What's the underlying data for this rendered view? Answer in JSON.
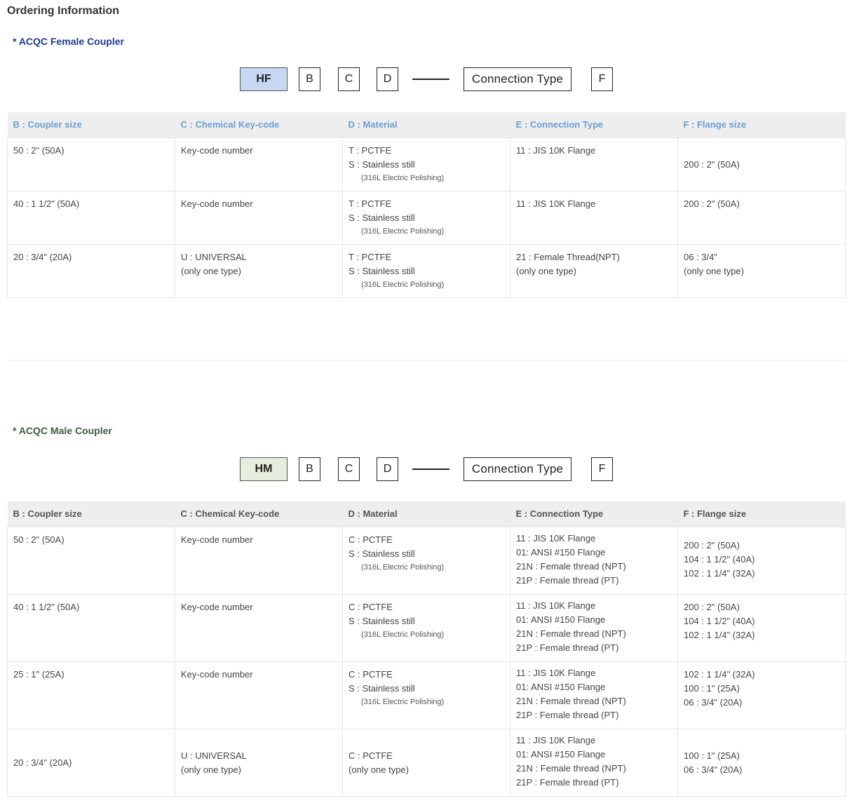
{
  "page_title": "Ordering Information",
  "female": {
    "title": "* ACQC Female Coupler",
    "code": {
      "prefix": "HF",
      "b": "B",
      "c": "C",
      "d": "D",
      "conn": "Connection Type",
      "f": "F"
    },
    "headers": [
      "B : Coupler size",
      "C : Chemical Key-code",
      "D : Material",
      "E : Connection Type",
      "F : Flange size"
    ],
    "rows": [
      {
        "b": [
          "50 : 2\" (50A)"
        ],
        "c": [
          "Key-code number"
        ],
        "d": [
          "T : PCTFE",
          "S : Stainless still"
        ],
        "d_note": "(316L Electric Polishing)",
        "e": [
          "11 : JIS 10K Flange"
        ],
        "f": [
          "200 : 2\" (50A)"
        ]
      },
      {
        "b": [
          "40 : 1 1/2\" (50A)"
        ],
        "c": [
          "Key-code number"
        ],
        "d": [
          "T : PCTFE",
          "S : Stainless still"
        ],
        "d_note": "(316L Electric Polishing)",
        "e": [
          "11 : JIS 10K Flange"
        ],
        "f": [
          "200 : 2\" (50A)"
        ]
      },
      {
        "b": [
          "20 : 3/4\" (20A)"
        ],
        "c": [
          "U : UNIVERSAL",
          "(only one type)"
        ],
        "d": [
          "T : PCTFE",
          "S : Stainless still"
        ],
        "d_note": "(316L Electric Polishing)",
        "e": [
          "21 : Female Thread(NPT)",
          "(only one type)"
        ],
        "f": [
          "06 : 3/4\"",
          "(only one type)"
        ]
      }
    ]
  },
  "male": {
    "title": "* ACQC Male Coupler",
    "code": {
      "prefix": "HM",
      "b": "B",
      "c": "C",
      "d": "D",
      "conn": "Connection Type",
      "f": "F"
    },
    "headers": [
      "B : Coupler size",
      "C : Chemical Key-code",
      "D : Material",
      "E : Connection Type",
      "F : Flange size"
    ],
    "rows": [
      {
        "b": [
          "50 : 2\" (50A)"
        ],
        "c": [
          "Key-code number"
        ],
        "d": [
          "C : PCTFE",
          "S : Stainless still"
        ],
        "d_note": "(316L Electric Polishing)",
        "e": [
          "11 : JIS 10K Flange",
          "01: ANSI #150 Flange",
          "21N : Female thread (NPT)",
          "21P : Female thread (PT)"
        ],
        "f": [
          "200 : 2\" (50A)",
          "104 : 1 1/2\" (40A)",
          "102 : 1 1/4\" (32A)"
        ]
      },
      {
        "b": [
          "40 : 1 1/2\" (50A)"
        ],
        "c": [
          "Key-code number"
        ],
        "d": [
          "C : PCTFE",
          "S : Stainless still"
        ],
        "d_note": "(316L Electric Polishing)",
        "e": [
          "11 : JIS 10K Flange",
          "01: ANSI #150 Flange",
          "21N : Female thread (NPT)",
          "21P : Female thread (PT)"
        ],
        "f": [
          "200 : 2\" (50A)",
          "104 : 1 1/2\" (40A)",
          "102 : 1 1/4\" (32A)"
        ]
      },
      {
        "b": [
          "25 : 1\" (25A)"
        ],
        "c": [
          "Key-code number"
        ],
        "d": [
          "C : PCTFE",
          "S : Stainless still"
        ],
        "d_note": "(316L Electric Polishing)",
        "e": [
          "11 : JIS 10K Flange",
          "01: ANSI #150 Flange",
          "21N : Female thread (NPT)",
          "21P : Female thread (PT)"
        ],
        "f": [
          "102 : 1 1/4\" (32A)",
          "100 : 1\" (25A)",
          "06 : 3/4\" (20A)"
        ]
      },
      {
        "b": [
          "20 : 3/4\" (20A)"
        ],
        "c": [
          "U : UNIVERSAL",
          "(only one type)"
        ],
        "d": [
          "C : PCTFE",
          "(only one type)"
        ],
        "d_note": "",
        "e": [
          "11 : JIS 10K Flange",
          "01: ANSI #150 Flange",
          "21N : Female thread (NPT)",
          "21P : Female thread (PT)"
        ],
        "f": [
          "100 : 1\" (25A)",
          "06 : 3/4\" (20A)"
        ]
      }
    ]
  },
  "colors": {
    "female_title": "#1f3a8f",
    "male_title": "#3f5a3f",
    "hf_box": "#c6d8f2",
    "hm_box": "#e6eddc",
    "female_header_text": "#6aa0d6",
    "header_bg": "#eeeeee"
  }
}
